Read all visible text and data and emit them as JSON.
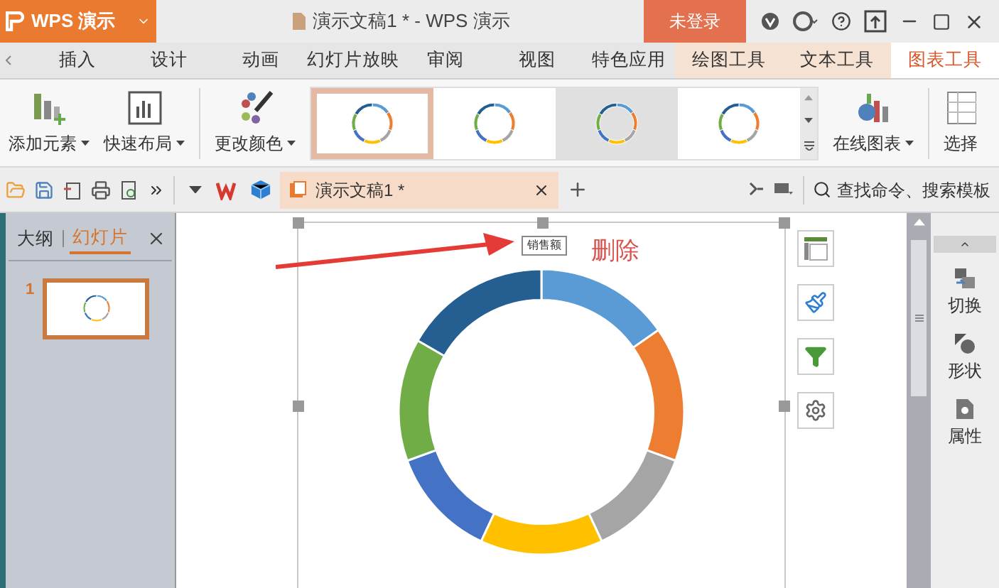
{
  "app_menu": {
    "label": "WPS 演示"
  },
  "window": {
    "title": "演示文稿1 * - WPS 演示"
  },
  "login_button": {
    "label": "未登录"
  },
  "ribbon_tabs": [
    {
      "label": "插入",
      "selected": false,
      "contextual": false
    },
    {
      "label": "设计",
      "selected": false,
      "contextual": false
    },
    {
      "label": "动画",
      "selected": false,
      "contextual": false
    },
    {
      "label": "幻灯片放映",
      "selected": false,
      "contextual": false
    },
    {
      "label": "审阅",
      "selected": false,
      "contextual": false
    },
    {
      "label": "视图",
      "selected": false,
      "contextual": false
    },
    {
      "label": "特色应用",
      "selected": false,
      "contextual": false
    },
    {
      "label": "绘图工具",
      "selected": false,
      "contextual": true
    },
    {
      "label": "文本工具",
      "selected": false,
      "contextual": true
    },
    {
      "label": "图表工具",
      "selected": true,
      "contextual": true
    }
  ],
  "ribbon_buttons": [
    {
      "label": "添加元素",
      "kind": "add"
    },
    {
      "label": "快速布局",
      "kind": "layout"
    },
    {
      "label": "更改颜色",
      "kind": "color"
    }
  ],
  "chart_styles": [
    {
      "selected": true
    },
    {
      "selected": false
    },
    {
      "selected": false
    },
    {
      "selected": false
    }
  ],
  "ribbon_buttons_right": [
    {
      "label": "在线图表",
      "kind": "online"
    },
    {
      "label": "选择",
      "kind": "select"
    }
  ],
  "doc_tabs": [
    {
      "label": "演示文稿1 *",
      "selected": true
    }
  ],
  "search": {
    "placeholder": "查找命令、搜索模板"
  },
  "side_panel": {
    "tabs": [
      {
        "label": "大纲",
        "selected": false
      },
      {
        "label": "幻灯片",
        "selected": true
      }
    ],
    "slides": [
      {
        "number": "1",
        "selected": true
      }
    ]
  },
  "slide": {
    "chart_title": "销售额",
    "annotation": "删除"
  },
  "task_pane": [
    {
      "label": "切换",
      "kind": "switch"
    },
    {
      "label": "形状",
      "kind": "shape"
    },
    {
      "label": "属性",
      "kind": "props"
    }
  ]
}
